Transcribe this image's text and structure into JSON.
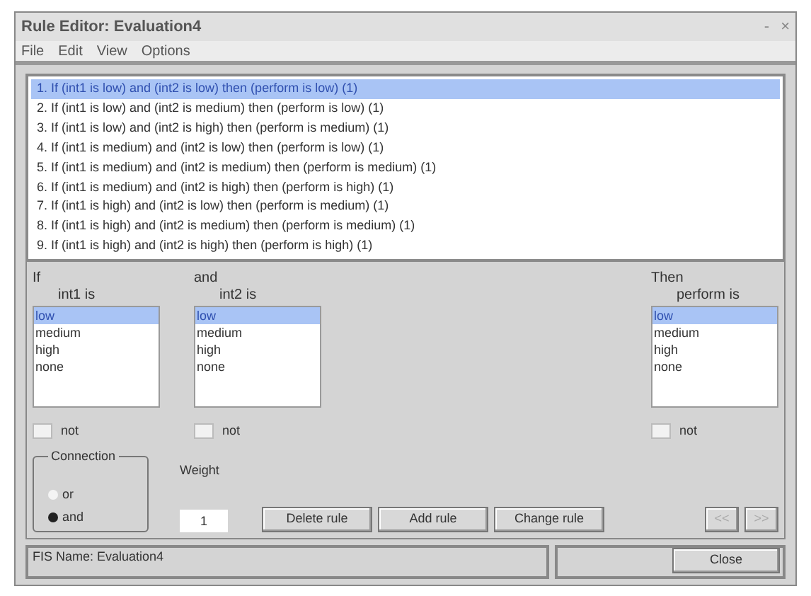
{
  "window": {
    "title": "Rule Editor: Evaluation4",
    "controls": [
      "-",
      "×"
    ]
  },
  "menu": [
    "File",
    "Edit",
    "View",
    "Options"
  ],
  "rules": [
    {
      "text": "1. If (int1 is low) and (int2 is low) then (perform is low) (1)",
      "selected": true
    },
    {
      "text": "2. If (int1 is low) and (int2 is medium) then (perform is low) (1)",
      "selected": false
    },
    {
      "text": "3. If (int1 is low) and (int2 is high) then (perform is medium) (1)",
      "selected": false
    },
    {
      "text": "4. If (int1 is medium) and (int2 is low) then (perform is low) (1)",
      "selected": false
    },
    {
      "text": "5. If (int1 is medium) and (int2 is medium) then (perform is medium) (1)",
      "selected": false
    },
    {
      "text": "6. If (int1 is medium) and (int2 is high) then (perform is high) (1)",
      "selected": false
    },
    {
      "text": "7. If (int1 is high) and (int2 is low) then (perform is medium) (1)",
      "selected": false
    },
    {
      "text": "8. If (int1 is high) and (int2 is medium) then (perform is medium) (1)",
      "selected": false
    },
    {
      "text": "9. If (int1 is high) and (int2 is high) then (perform is high) (1)",
      "selected": false
    }
  ],
  "variables": [
    {
      "heading": "If",
      "label": "int1 is",
      "options": [
        {
          "text": "low",
          "selected": true
        },
        {
          "text": "medium",
          "selected": false
        },
        {
          "text": "high",
          "selected": false
        },
        {
          "text": "none",
          "selected": false
        }
      ],
      "not_label": "not",
      "not_checked": false
    },
    {
      "heading": "and",
      "label": "int2 is",
      "options": [
        {
          "text": "low",
          "selected": true
        },
        {
          "text": "medium",
          "selected": false
        },
        {
          "text": "high",
          "selected": false
        },
        {
          "text": "none",
          "selected": false
        }
      ],
      "not_label": "not",
      "not_checked": false
    },
    {
      "heading": "Then",
      "label": "perform is",
      "options": [
        {
          "text": "low",
          "selected": true
        },
        {
          "text": "medium",
          "selected": false
        },
        {
          "text": "high",
          "selected": false
        },
        {
          "text": "none",
          "selected": false
        }
      ],
      "not_label": "not",
      "not_checked": false
    }
  ],
  "connection": {
    "title": "Connection",
    "options": [
      {
        "label": "or",
        "selected": false
      },
      {
        "label": "and",
        "selected": true
      }
    ]
  },
  "weight": {
    "label": "Weight",
    "value": "1"
  },
  "buttons": [
    "Delete rule",
    "Add rule",
    "Change rule"
  ],
  "nav_buttons": [
    "<<",
    ">>"
  ],
  "status": "FIS Name: Evaluation4",
  "close": "Close"
}
